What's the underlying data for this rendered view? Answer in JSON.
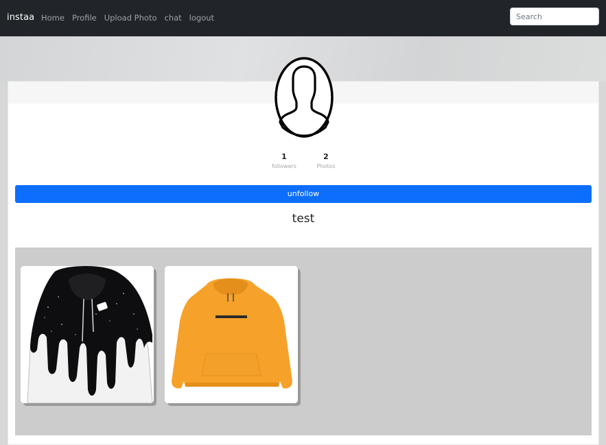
{
  "navbar": {
    "brand": "instaa",
    "links": [
      "Home",
      "Profile",
      "Upload Photo",
      "chat",
      "logout"
    ],
    "search_placeholder": "Search"
  },
  "profile": {
    "avatar_icon": "user-silhouette-icon",
    "stats": [
      {
        "value": "1",
        "label": "followers"
      },
      {
        "value": "2",
        "label": "Photos"
      }
    ],
    "follow_button": "unfollow",
    "username": "test"
  },
  "gallery": {
    "photos": [
      {
        "subject": "black and white dripping galaxy hoodie"
      },
      {
        "subject": "orange hoodie"
      }
    ]
  },
  "colors": {
    "navbar": "#212529",
    "primary": "#0d6efd",
    "gallery_bg": "#cccccc"
  }
}
